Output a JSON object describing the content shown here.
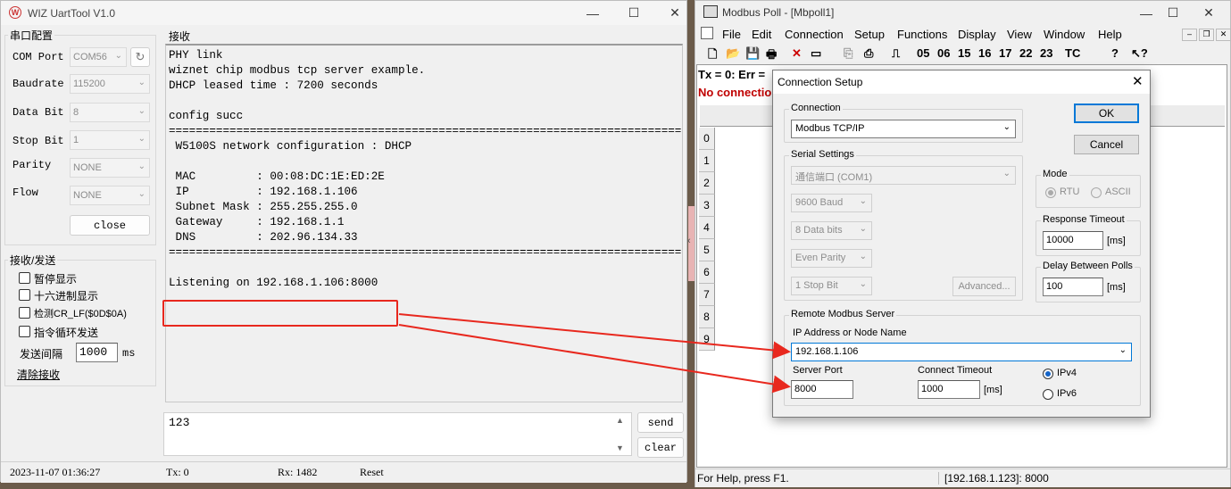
{
  "uart": {
    "title": "WIZ UartTool V1.0",
    "serial_group": "串口配置",
    "com_port_label": "COM Port",
    "com_port_value": "COM56",
    "baudrate_label": "Baudrate",
    "baudrate_value": "115200",
    "data_bit_label": "Data Bit",
    "data_bit_value": "8",
    "stop_bit_label": "Stop Bit",
    "stop_bit_value": "1",
    "parity_label": "Parity",
    "parity_value": "NONE",
    "flow_label": "Flow",
    "flow_value": "NONE",
    "close_button": "close",
    "txrx_group": "接收/发送",
    "options": [
      "暂停显示",
      "十六进制显示",
      "检测CR_LF($0D$0A)",
      "指令循环发送"
    ],
    "interval_label": "发送间隔",
    "interval_value": "1000",
    "interval_unit": "ms",
    "clear_recv_link": "清除接收",
    "recv_label": "接收",
    "recv_lines": [
      "PHY link",
      "wiznet chip modbus tcp server example.",
      "DHCP leased time : 7200 seconds",
      "",
      "config succ",
      "==============================================================================================",
      " W5100S network configuration : DHCP",
      "",
      " MAC         : 00:08:DC:1E:ED:2E",
      " IP          : 192.168.1.106",
      " Subnet Mask : 255.255.255.0",
      " Gateway     : 192.168.1.1",
      " DNS         : 202.96.134.33",
      "==============================================================================================",
      "",
      "Listening on 192.168.1.106:8000"
    ],
    "send_text": "123",
    "send_button": "send",
    "clear_button": "clear",
    "status_time": "2023-11-07 01:36:27",
    "status_tx": "Tx: 0",
    "status_rx": "Rx: 1482",
    "status_reset": "Reset"
  },
  "mbpoll": {
    "title": "Modbus Poll - [Mbpoll1]",
    "menu": [
      "File",
      "Edit",
      "Connection",
      "Setup",
      "Functions",
      "Display",
      "View",
      "Window",
      "Help"
    ],
    "toolbar_codes": [
      "05",
      "06",
      "15",
      "16",
      "17",
      "22",
      "23",
      "TC"
    ],
    "info_line": "Tx = 0: Err =",
    "no_connection": "No connection",
    "row_numbers": [
      "0",
      "1",
      "2",
      "3",
      "4",
      "5",
      "6",
      "7",
      "8",
      "9"
    ],
    "status_help": "For Help, press F1.",
    "status_addr": "[192.168.1.123]: 8000"
  },
  "dialog": {
    "title": "Connection Setup",
    "connection_legend": "Connection",
    "connection_value": "Modbus TCP/IP",
    "serial_legend": "Serial Settings",
    "serial_port": "通信端口 (COM1)",
    "baud": "9600 Baud",
    "data_bits": "8 Data bits",
    "parity": "Even Parity",
    "stop_bits": "1 Stop Bit",
    "advanced_button": "Advanced...",
    "ok_button": "OK",
    "cancel_button": "Cancel",
    "mode_legend": "Mode",
    "mode_rtu": "RTU",
    "mode_ascii": "ASCII",
    "response_legend": "Response Timeout",
    "response_value": "10000",
    "response_unit": "[ms]",
    "delay_legend": "Delay Between Polls",
    "delay_value": "100",
    "delay_unit": "[ms]",
    "remote_legend": "Remote Modbus Server",
    "ip_label": "IP Address or Node Name",
    "ip_value": "192.168.1.106",
    "port_label": "Server Port",
    "port_value": "8000",
    "timeout_label": "Connect Timeout",
    "timeout_value": "1000",
    "timeout_unit": "[ms]",
    "ipv4": "IPv4",
    "ipv6": "IPv6"
  },
  "colors": {
    "highlight": "#e8281e",
    "ok_focus": "#0078d7",
    "no_connection": "#c00000"
  }
}
